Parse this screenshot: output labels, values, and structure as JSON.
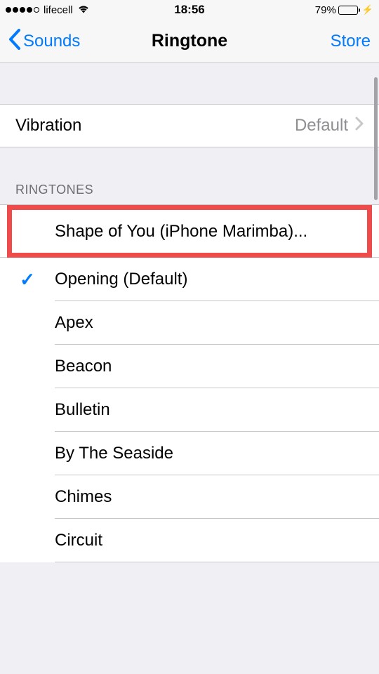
{
  "status": {
    "carrier": "lifecell",
    "time": "18:56",
    "battery_pct": "79%"
  },
  "nav": {
    "back_label": "Sounds",
    "title": "Ringtone",
    "right_action": "Store"
  },
  "vibration": {
    "label": "Vibration",
    "value": "Default"
  },
  "sections": {
    "ringtones_header": "RINGTONES"
  },
  "ringtones": [
    {
      "label": "Shape of You (iPhone Marimba)...",
      "selected": false,
      "highlighted": true
    },
    {
      "label": "Opening (Default)",
      "selected": true
    },
    {
      "label": "Apex",
      "selected": false
    },
    {
      "label": "Beacon",
      "selected": false
    },
    {
      "label": "Bulletin",
      "selected": false
    },
    {
      "label": "By The Seaside",
      "selected": false
    },
    {
      "label": "Chimes",
      "selected": false
    },
    {
      "label": "Circuit",
      "selected": false
    }
  ]
}
